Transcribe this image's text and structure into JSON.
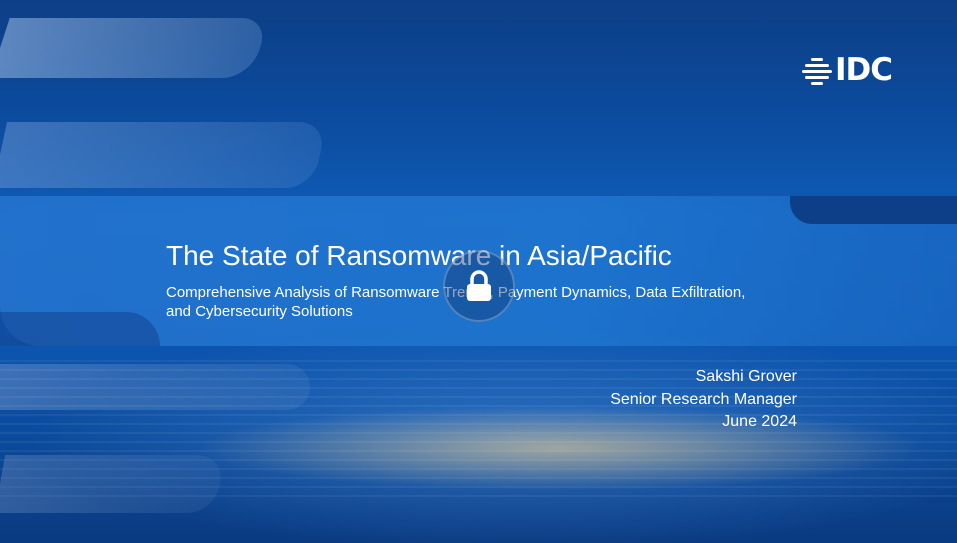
{
  "brand": {
    "logo_text": "IDC"
  },
  "slide": {
    "title": "The State of Ransomware in Asia/Pacific",
    "subtitle": "Comprehensive Analysis of Ransomware Trends, Payment Dynamics, Data Exfiltration, and Cybersecurity Solutions",
    "author_name": "Sakshi Grover",
    "author_role": "Senior Research Manager",
    "date": "June 2024"
  },
  "overlay": {
    "icon": "lock-icon"
  },
  "colors": {
    "background_primary": "#0b4a9c",
    "band": "#237dd7",
    "text": "#ffffff"
  }
}
